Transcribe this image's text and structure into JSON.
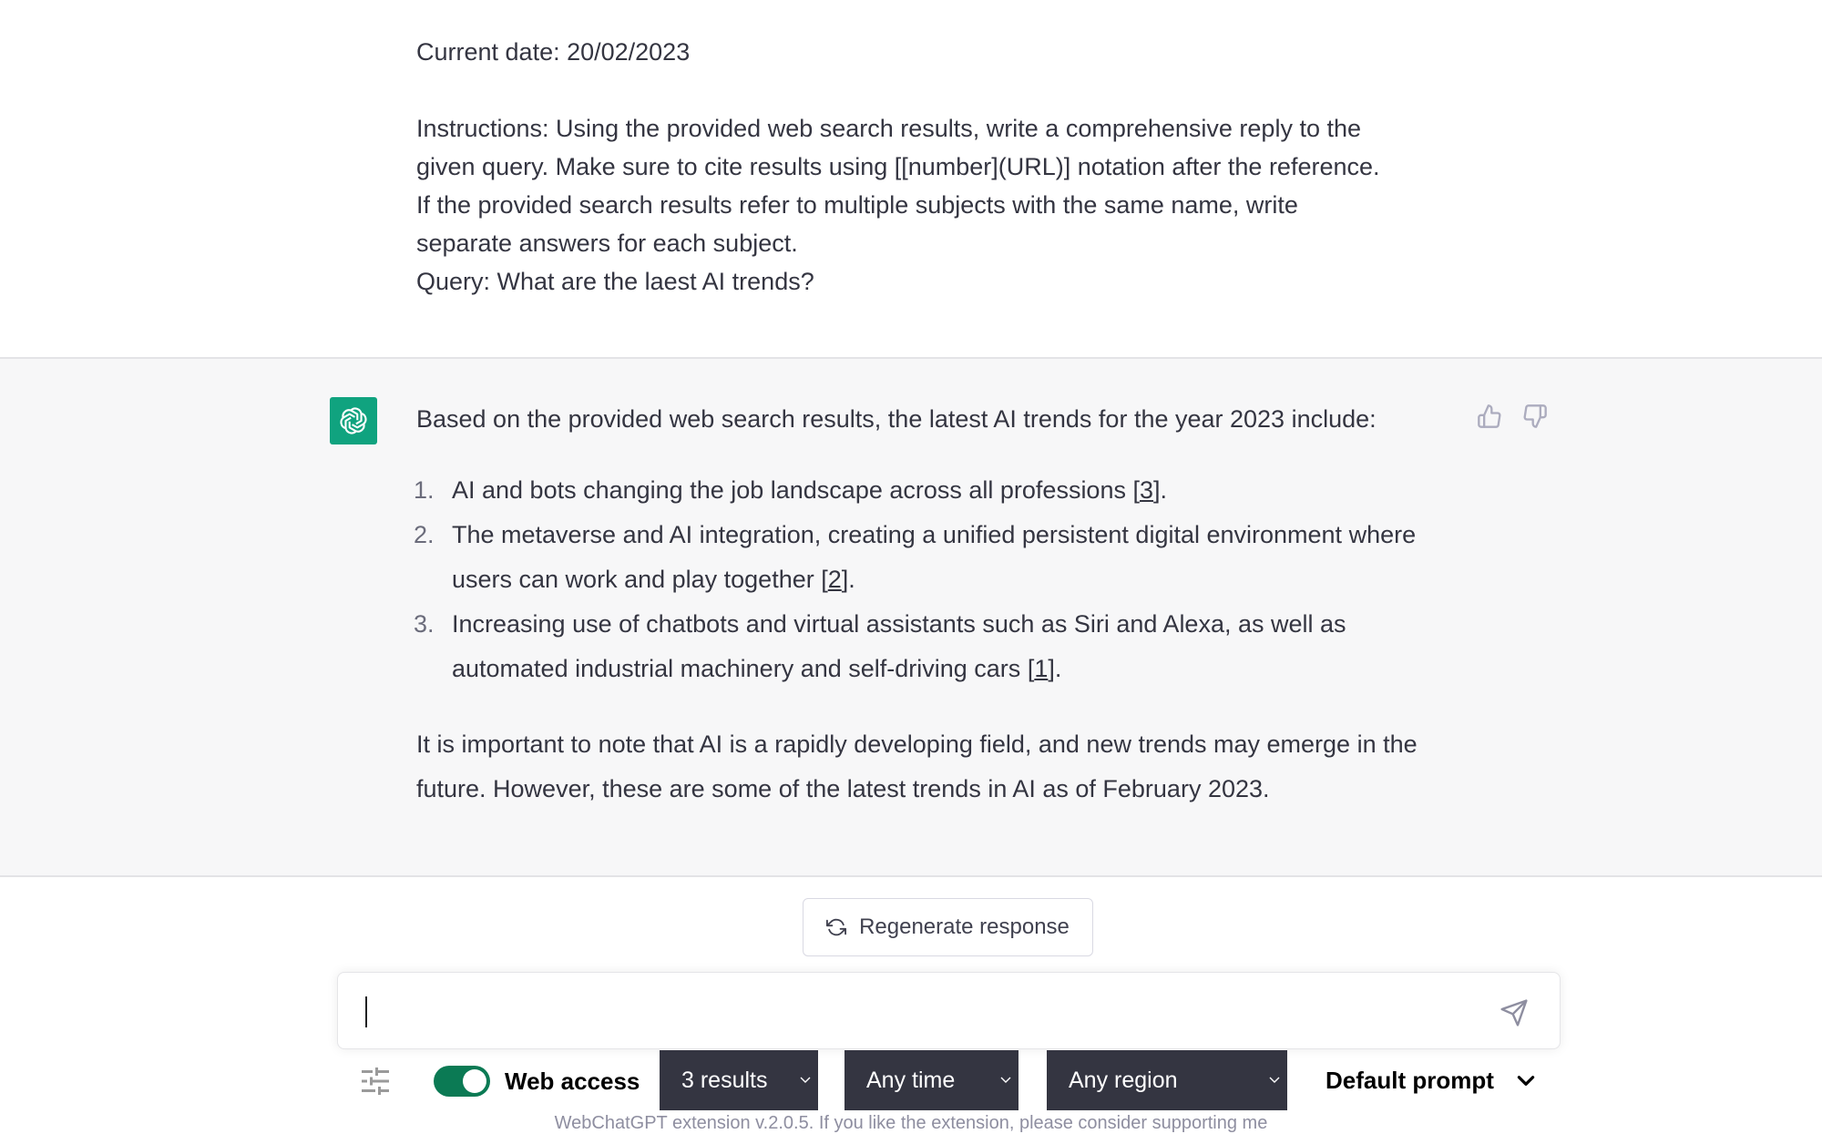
{
  "user_message": {
    "date_line": "Current date: 20/02/2023",
    "instruction_lines": [
      "Instructions: Using the provided web search results, write a comprehensive reply to the",
      "given query. Make sure to cite results using [[number](URL)] notation after the reference.",
      "If the provided search results refer to multiple subjects with the same name, write",
      "separate answers for each subject.",
      "Query: What are the laest AI trends?"
    ]
  },
  "assistant_message": {
    "avatar_icon": "openai-logo-icon",
    "intro": "Based on the provided web search results, the latest AI trends for the year 2023 include:",
    "items": [
      {
        "number": "1.",
        "text": "AI and bots changing the job landscape across all professions ",
        "cite": "3",
        "end": "."
      },
      {
        "number": "2.",
        "text": "The metaverse and AI integration, creating a unified persistent digital environment where users can work and play together ",
        "cite": "2",
        "end": "."
      },
      {
        "number": "3.",
        "text": "Increasing use of chatbots and virtual assistants such as Siri and Alexa, as well as automated industrial machinery and self-driving cars ",
        "cite": "1",
        "end": "."
      }
    ],
    "closing": "It is important to note that AI is a rapidly developing field, and new trends may emerge in the future. However, these are some of the latest trends in AI as of February 2023.",
    "feedback": {
      "thumbs_up_icon": "thumbs-up-icon",
      "thumbs_down_icon": "thumbs-down-icon"
    }
  },
  "regenerate_button": {
    "label": "Regenerate response",
    "icon": "refresh-icon"
  },
  "composer": {
    "value": "",
    "placeholder": "",
    "send_icon": "send-icon"
  },
  "controls": {
    "settings_icon": "sliders-icon",
    "web_access": {
      "label": "Web access",
      "enabled": true,
      "accent": "#0b7a54"
    },
    "results_select": {
      "value": "3 results"
    },
    "time_select": {
      "value": "Any time"
    },
    "region_select": {
      "value": "Any region"
    },
    "prompt_select": {
      "value": "Default prompt"
    }
  },
  "footer_text": "WebChatGPT extension v.2.0.5. If you like the extension, please consider supporting me",
  "colors": {
    "assistant_bg": "#f7f7f8",
    "brand_green": "#10a37f",
    "select_bg": "#343541",
    "text": "#343541"
  }
}
